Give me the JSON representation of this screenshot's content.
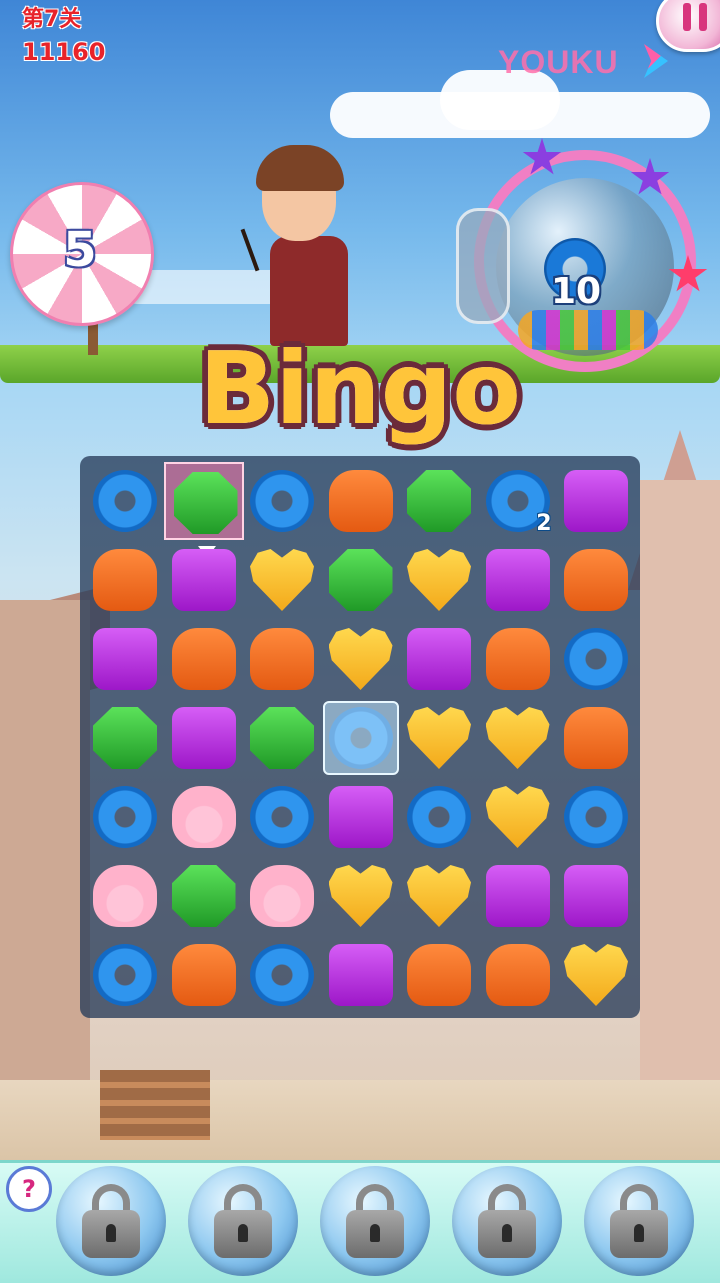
{
  "hud": {
    "level_label": "第7关",
    "score": "11160"
  },
  "watermark": "YOUKU",
  "moves": {
    "remaining": "5"
  },
  "goal": {
    "icon": "blue-donut-icon",
    "count": "10"
  },
  "banner": "Bingo",
  "board": {
    "rows": 7,
    "cols": 7,
    "pieces": [
      [
        "donut",
        "octagon",
        "donut",
        "drop",
        "octagon",
        "donut",
        "square"
      ],
      [
        "drop",
        "square",
        "heart",
        "octagon",
        "heart",
        "square",
        "drop"
      ],
      [
        "square",
        "drop",
        "drop",
        "heart",
        "square",
        "drop",
        "donut"
      ],
      [
        "octagon",
        "square",
        "octagon",
        "donut",
        "heart",
        "heart",
        "drop"
      ],
      [
        "donut",
        "paw",
        "donut",
        "square",
        "donut",
        "heart",
        "donut"
      ],
      [
        "paw",
        "octagon",
        "paw",
        "heart",
        "heart",
        "square",
        "square"
      ],
      [
        "donut",
        "drop",
        "donut",
        "square",
        "drop",
        "drop",
        "heart"
      ]
    ],
    "selected": [
      0,
      1
    ],
    "frozen": [
      [
        3,
        3
      ]
    ],
    "badges": [
      {
        "row": 0,
        "col": 5,
        "text": "2"
      }
    ]
  },
  "boosters": {
    "help_label": "?",
    "items": [
      {
        "state": "locked"
      },
      {
        "state": "locked"
      },
      {
        "state": "locked"
      },
      {
        "state": "locked"
      },
      {
        "state": "locked"
      }
    ]
  },
  "colors": {
    "score_red": "#e8232a",
    "bingo_fill": "#ffc53a",
    "donut": "#2f95ee",
    "square": "#b830dd",
    "drop": "#f06a22",
    "octagon": "#3cc33d",
    "heart": "#fbc22f",
    "paw": "#ffb8d0"
  }
}
